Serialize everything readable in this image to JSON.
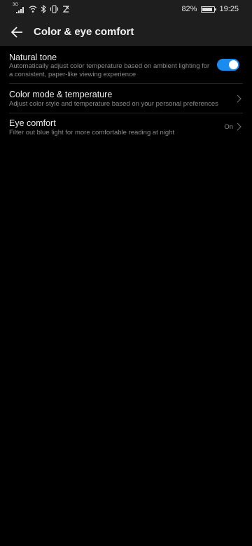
{
  "status_bar": {
    "network_label": "3G",
    "battery_percent": "82%",
    "battery_level": 0.82,
    "time": "19:25",
    "icons": [
      "signal-icon",
      "wifi-icon",
      "bluetooth-icon",
      "vibrate-icon",
      "data-saver-icon",
      "battery-icon"
    ]
  },
  "app_bar": {
    "back_icon": "arrow-left-icon",
    "title": "Color & eye comfort"
  },
  "settings": {
    "natural_tone": {
      "title": "Natural tone",
      "description": "Automatically adjust color temperature based on ambient lighting for a consistent, paper-like viewing experience",
      "enabled": true
    },
    "color_mode": {
      "title": "Color mode & temperature",
      "description": "Adjust color style and temperature based on your personal preferences",
      "icon": "chevron-right-icon"
    },
    "eye_comfort": {
      "title": "Eye comfort",
      "description": "Filter out blue light for more comfortable reading at night",
      "value": "On",
      "icon": "chevron-right-icon"
    }
  },
  "colors": {
    "background": "#000000",
    "bar_background": "#1e1e1e",
    "accent": "#1a8cf0",
    "primary_text": "#f0f0f0",
    "secondary_text": "#8a8a8a"
  }
}
